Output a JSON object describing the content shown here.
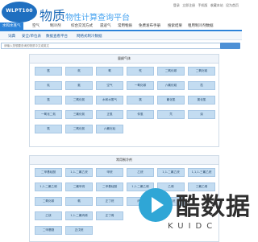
{
  "header": {
    "logo_text": "WLPT100",
    "title_main": "物质",
    "title_sub": "物性计算查询平台",
    "top_links": [
      "登录",
      "立即注册",
      "手机版",
      "收藏本站",
      "设为首页"
    ]
  },
  "main_nav": {
    "items": [
      "水和水蒸气",
      "空气",
      "制冷剂",
      "综合交流方式",
      "遗迹气",
      "常用物质",
      "免费发布手册",
      "搜索结果",
      "租用制冷剂数据"
    ]
  },
  "sub_nav": {
    "items": [
      "词典",
      "安全/单位表",
      "数据查看平台",
      "网络式制冷数据"
    ]
  },
  "search": {
    "placeholder": "请输入您想要查询的物质中文或英文"
  },
  "panels": [
    {
      "title": "量纲气体",
      "rows": [
        [
          "氩",
          "氮",
          "氧",
          "氖",
          "二氧化碳",
          "二氧化硫"
        ],
        [
          "氦",
          "氪",
          "空气",
          "一氧化碳",
          "六氟化硫",
          "氙"
        ],
        [
          "氢",
          "二氧化氮",
          "水和水蒸气",
          "氯",
          "氟化氢",
          "氯化氢"
        ],
        [
          "一氧化二氮",
          "三氟化氮",
          "正氢",
          "仲氢",
          "氘",
          "溴"
        ],
        [
          "氡",
          "二氧化氮",
          "六氟化硅",
          "",
          "",
          ""
        ]
      ]
    },
    {
      "title": "常用制冷剂",
      "rows": [
        [
          "二甲基硅醚",
          "1,1-二氟乙烷",
          "甲烷",
          "乙烷",
          "1,1-二氟乙烷",
          "1,1,1-三氟乙烷"
        ],
        [
          "1,1-二氟乙烯",
          "二氟甲烷",
          "二甲基硅醚",
          "1,1-二氟乙烯",
          "乙烯",
          "三氟乙烯"
        ],
        [
          "二氧化碳",
          "氨",
          "正丁烷",
          "丙烯",
          "异丁烷",
          ""
        ],
        [
          "乙炔",
          "1,1-二氟丙烯",
          "正丁烯",
          "",
          "",
          ""
        ],
        [
          "二甲基醚",
          "正戊烷",
          "",
          "",
          "",
          ""
        ]
      ]
    }
  ],
  "watermark": {
    "text": "酷数据",
    "sub": "KUIDC"
  }
}
